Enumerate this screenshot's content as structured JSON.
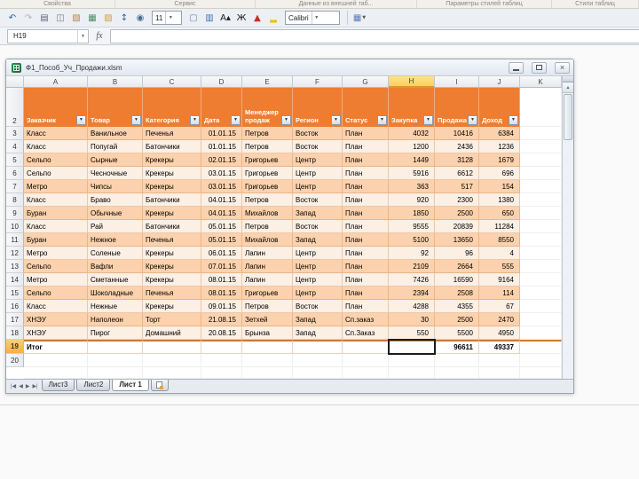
{
  "ribbon": {
    "groups": [
      {
        "label": "Свойства"
      },
      {
        "label": "Сервис"
      },
      {
        "label": "Данные из внешней таб..."
      },
      {
        "label": "Параметры стилей таблиц"
      },
      {
        "label": "Стили таблиц"
      },
      {
        "label": ""
      }
    ]
  },
  "toolbar": {
    "font_size": "11",
    "font_name": "Calibri",
    "icons_left": [
      {
        "name": "undo-icon",
        "glyph": "↶",
        "color": "#2e64a8"
      },
      {
        "name": "redo-icon",
        "glyph": "↷",
        "color": "#aab3bc"
      },
      {
        "name": "print-icon",
        "glyph": "▤",
        "color": "#5c6a7a"
      },
      {
        "name": "print-preview-icon",
        "glyph": "◫",
        "color": "#6f7d8c"
      },
      {
        "name": "paste-icon",
        "glyph": "▧",
        "color": "#b5873f"
      },
      {
        "name": "picture-icon",
        "glyph": "▦",
        "color": "#4d8b63"
      },
      {
        "name": "open-folder-icon",
        "glyph": "▨",
        "color": "#d2a23a"
      },
      {
        "name": "sort-filter-icon",
        "glyph": "↕",
        "color": "#2f62a8"
      },
      {
        "name": "zoom-icon",
        "glyph": "◉",
        "color": "#4c6a8c"
      }
    ],
    "icons_mid": [
      {
        "name": "new-doc-icon",
        "glyph": "▢",
        "color": "#7b8592"
      },
      {
        "name": "chart-icon",
        "glyph": "▥",
        "color": "#3f74b8"
      },
      {
        "name": "grow-font-icon",
        "glyph": "A▴",
        "color": "#1b1b1b"
      },
      {
        "name": "bold-icon",
        "glyph": "Ж",
        "color": "#1b1b1b"
      },
      {
        "name": "border-color-icon",
        "glyph": "▲",
        "color": "#c23026"
      },
      {
        "name": "fill-color-icon",
        "glyph": "▂",
        "color": "#edc006"
      }
    ],
    "icons_right": [
      {
        "name": "table-style-icon",
        "glyph": "▦",
        "color": "#5b7fb4"
      }
    ]
  },
  "formula_bar": {
    "name_box": "H19",
    "fx_label": "fx",
    "formula_value": ""
  },
  "window": {
    "title": "Ф1_Пособ_Уч_Продажи.xlsm"
  },
  "sheet": {
    "column_letters": [
      "A",
      "B",
      "C",
      "D",
      "E",
      "F",
      "G",
      "H",
      "I",
      "J",
      "K"
    ],
    "selected_column": "H",
    "selected_cell": "H19",
    "table": {
      "header_row_number": "2",
      "headers": [
        "Заказчик",
        "Товар",
        "Категория",
        "Дата",
        "Менеджер продаж",
        "Регион",
        "Статус",
        "Закупка",
        "Продажа",
        "Доход"
      ],
      "rows": [
        [
          "3",
          "Класс",
          "Ванильное",
          "Печенья",
          "01.01.15",
          "Петров",
          "Восток",
          "План",
          "4032",
          "10416",
          "6384"
        ],
        [
          "4",
          "Класс",
          "Попугай",
          "Батончики",
          "01.01.15",
          "Петров",
          "Восток",
          "План",
          "1200",
          "2436",
          "1236"
        ],
        [
          "5",
          "Сельпо",
          "Сырные",
          "Крекеры",
          "02.01.15",
          "Григорьев",
          "Центр",
          "План",
          "1449",
          "3128",
          "1679"
        ],
        [
          "6",
          "Сельпо",
          "Чесночные",
          "Крекеры",
          "03.01.15",
          "Григорьев",
          "Центр",
          "План",
          "5916",
          "6612",
          "696"
        ],
        [
          "7",
          "Метро",
          "Чипсы",
          "Крекеры",
          "03.01.15",
          "Григорьев",
          "Центр",
          "План",
          "363",
          "517",
          "154"
        ],
        [
          "8",
          "Класс",
          "Браво",
          "Батончики",
          "04.01.15",
          "Петров",
          "Восток",
          "План",
          "920",
          "2300",
          "1380"
        ],
        [
          "9",
          "Буран",
          "Обычные",
          "Крекеры",
          "04.01.15",
          "Михайлов",
          "Запад",
          "План",
          "1850",
          "2500",
          "650"
        ],
        [
          "10",
          "Класс",
          "Рай",
          "Батончики",
          "05.01.15",
          "Петров",
          "Восток",
          "План",
          "9555",
          "20839",
          "11284"
        ],
        [
          "11",
          "Буран",
          "Нежное",
          "Печенья",
          "05.01.15",
          "Михайлов",
          "Запад",
          "План",
          "5100",
          "13650",
          "8550"
        ],
        [
          "12",
          "Метро",
          "Соленые",
          "Крекеры",
          "06.01.15",
          "Лапин",
          "Центр",
          "План",
          "92",
          "96",
          "4"
        ],
        [
          "13",
          "Сельпо",
          "Вафли",
          "Крекеры",
          "07.01.15",
          "Лапин",
          "Центр",
          "План",
          "2109",
          "2664",
          "555"
        ],
        [
          "14",
          "Метро",
          "Сметанные",
          "Крекеры",
          "08.01.15",
          "Лапин",
          "Центр",
          "План",
          "7426",
          "16590",
          "9164"
        ],
        [
          "15",
          "Сельпо",
          "Шоколадные",
          "Печенья",
          "08.01.15",
          "Григорьев",
          "Центр",
          "План",
          "2394",
          "2508",
          "114"
        ],
        [
          "16",
          "Класс",
          "Нежные",
          "Крекеры",
          "09.01.15",
          "Петров",
          "Восток",
          "План",
          "4288",
          "4355",
          "67"
        ],
        [
          "17",
          "ХНЭУ",
          "Наполеон",
          "Торт",
          "21.08.15",
          "Зетхей",
          "Запад",
          "Сп.заказ",
          "30",
          "2500",
          "2470"
        ],
        [
          "18",
          "ХНЭУ",
          "Пирог",
          "Домашний",
          "20.08.15",
          "Брынза",
          "Запад",
          "Сп.Заказ",
          "550",
          "5500",
          "4950"
        ]
      ],
      "total_row_number": "19",
      "total_label": "Итог",
      "total_sales": "96611",
      "total_income": "49337",
      "empty_row_number": "20"
    },
    "tabs": {
      "items": [
        "Лист3",
        "Лист2",
        "Лист 1"
      ],
      "active": "Лист 1"
    }
  },
  "colors": {
    "table_header_orange": "#ee7d31",
    "band_odd": "#fbd2ad",
    "band_even": "#fcefe4",
    "selected_column_header": "#fdd05b"
  }
}
